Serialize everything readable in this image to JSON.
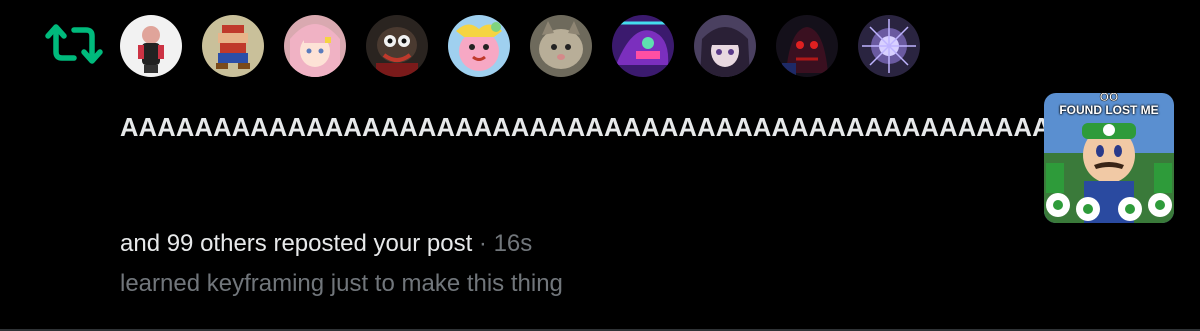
{
  "notification": {
    "type_icon": "repost-icon",
    "accent_color": "#00ba7c",
    "avatars": [
      {
        "icon": "avatar-figure-white-background"
      },
      {
        "icon": "avatar-pixel-mario"
      },
      {
        "icon": "avatar-pink-hair-anime"
      },
      {
        "icon": "avatar-dark-character"
      },
      {
        "icon": "avatar-pink-puffball"
      },
      {
        "icon": "avatar-cat-photo"
      },
      {
        "icon": "avatar-purple-creature"
      },
      {
        "icon": "avatar-dark-hair-anime"
      },
      {
        "icon": "avatar-red-dark-character"
      },
      {
        "icon": "avatar-purple-abstract"
      }
    ],
    "post_text": "AAAAAAAAAAAAAAAAAAAAAAAAAAAAAAAAAAAAAAAAAAAAAAAAAAH",
    "summary": "and 99 others reposted your post",
    "separator": "·",
    "timestamp": "16s",
    "preview_text": "learned keyframing just to make this thing",
    "thumbnail": {
      "icon": "video-thumbnail-icon",
      "caption": "FOUND LOST ME"
    }
  },
  "colors": {
    "background": "#000000",
    "primary_text": "#e7e9ea",
    "secondary_text": "#71767b",
    "repost_green": "#00ba7c"
  }
}
